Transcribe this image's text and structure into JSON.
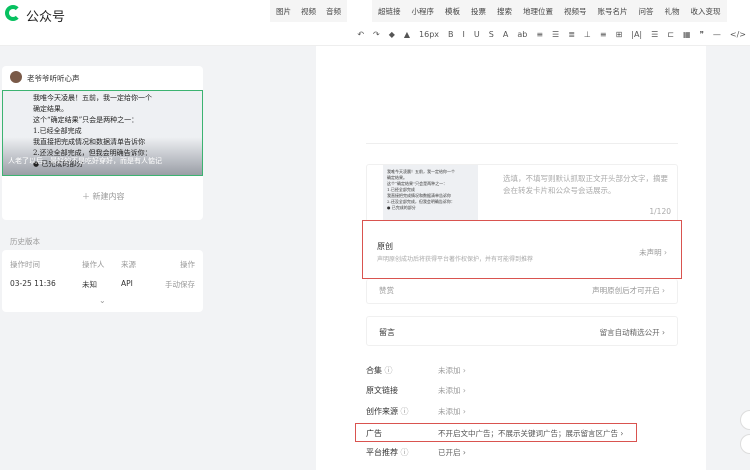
{
  "header": {
    "brand": "公众号",
    "menu1": [
      "图片",
      "视频",
      "音频"
    ],
    "menu2": [
      "超链接",
      "小程序",
      "模板",
      "投票",
      "搜索",
      "地理位置",
      "视频号",
      "账号名片",
      "问答",
      "礼物",
      "收入变现"
    ]
  },
  "toolbar": {
    "font_size": "16px",
    "items": [
      "↶",
      "↷",
      "◆",
      "▲",
      "B",
      "I",
      "U",
      "S",
      "A",
      "ab",
      "≡",
      "☰",
      "≣",
      "⊥",
      "≡",
      "⊞",
      "|A|",
      "☰",
      "⊏",
      "▦",
      "❞",
      "—",
      "</>"
    ]
  },
  "article": {
    "author": "老爷爷听听心声",
    "caption": "人老了以后，最好的不是吃好穿好，而是有人惦记",
    "thumb_lines": [
      "我唯今天凌晨！五前，我一定给你一个",
      "确定结果。",
      "这个“确定结果”只会是两种之一：",
      "1.已经全部完成",
      "我直接把完成情况和数据清单告诉你",
      "2.还没全部完成，但我会明确告诉你：",
      "● 已完成的部分"
    ],
    "new_content": "新建内容"
  },
  "history": {
    "title": "历史版本",
    "headers": [
      "操作时间",
      "操作人",
      "来源",
      "操作"
    ],
    "row": [
      "03-25 11:36",
      "未知",
      "API",
      "手动保存"
    ]
  },
  "summary": {
    "placeholder": "选填，不填写则默认抓取正文开头部分文字，摘要会在转发卡片和公众号会话展示。",
    "count": "1/120"
  },
  "original": {
    "title": "原创",
    "desc": "声明原创成功后将获得平台著作权保护，并有可能得到推荐",
    "value": "未声明 ›"
  },
  "reward": {
    "title": "赞赏",
    "value": "声明原创后才可开启 ›"
  },
  "comment": {
    "title": "留言",
    "value": "留言自动精选公开 ›"
  },
  "settings": [
    {
      "label": "合集",
      "help": true,
      "value": "未添加 ›"
    },
    {
      "label": "原文链接",
      "help": false,
      "value": "未添加 ›"
    },
    {
      "label": "创作来源",
      "help": true,
      "value": "未添加 ›"
    },
    {
      "label": "广告",
      "help": false,
      "value": "不开启文中广告；不展示关键词广告；展示留言区广告 ›"
    },
    {
      "label": "平台推荐",
      "help": true,
      "value": "已开启 ›"
    }
  ]
}
